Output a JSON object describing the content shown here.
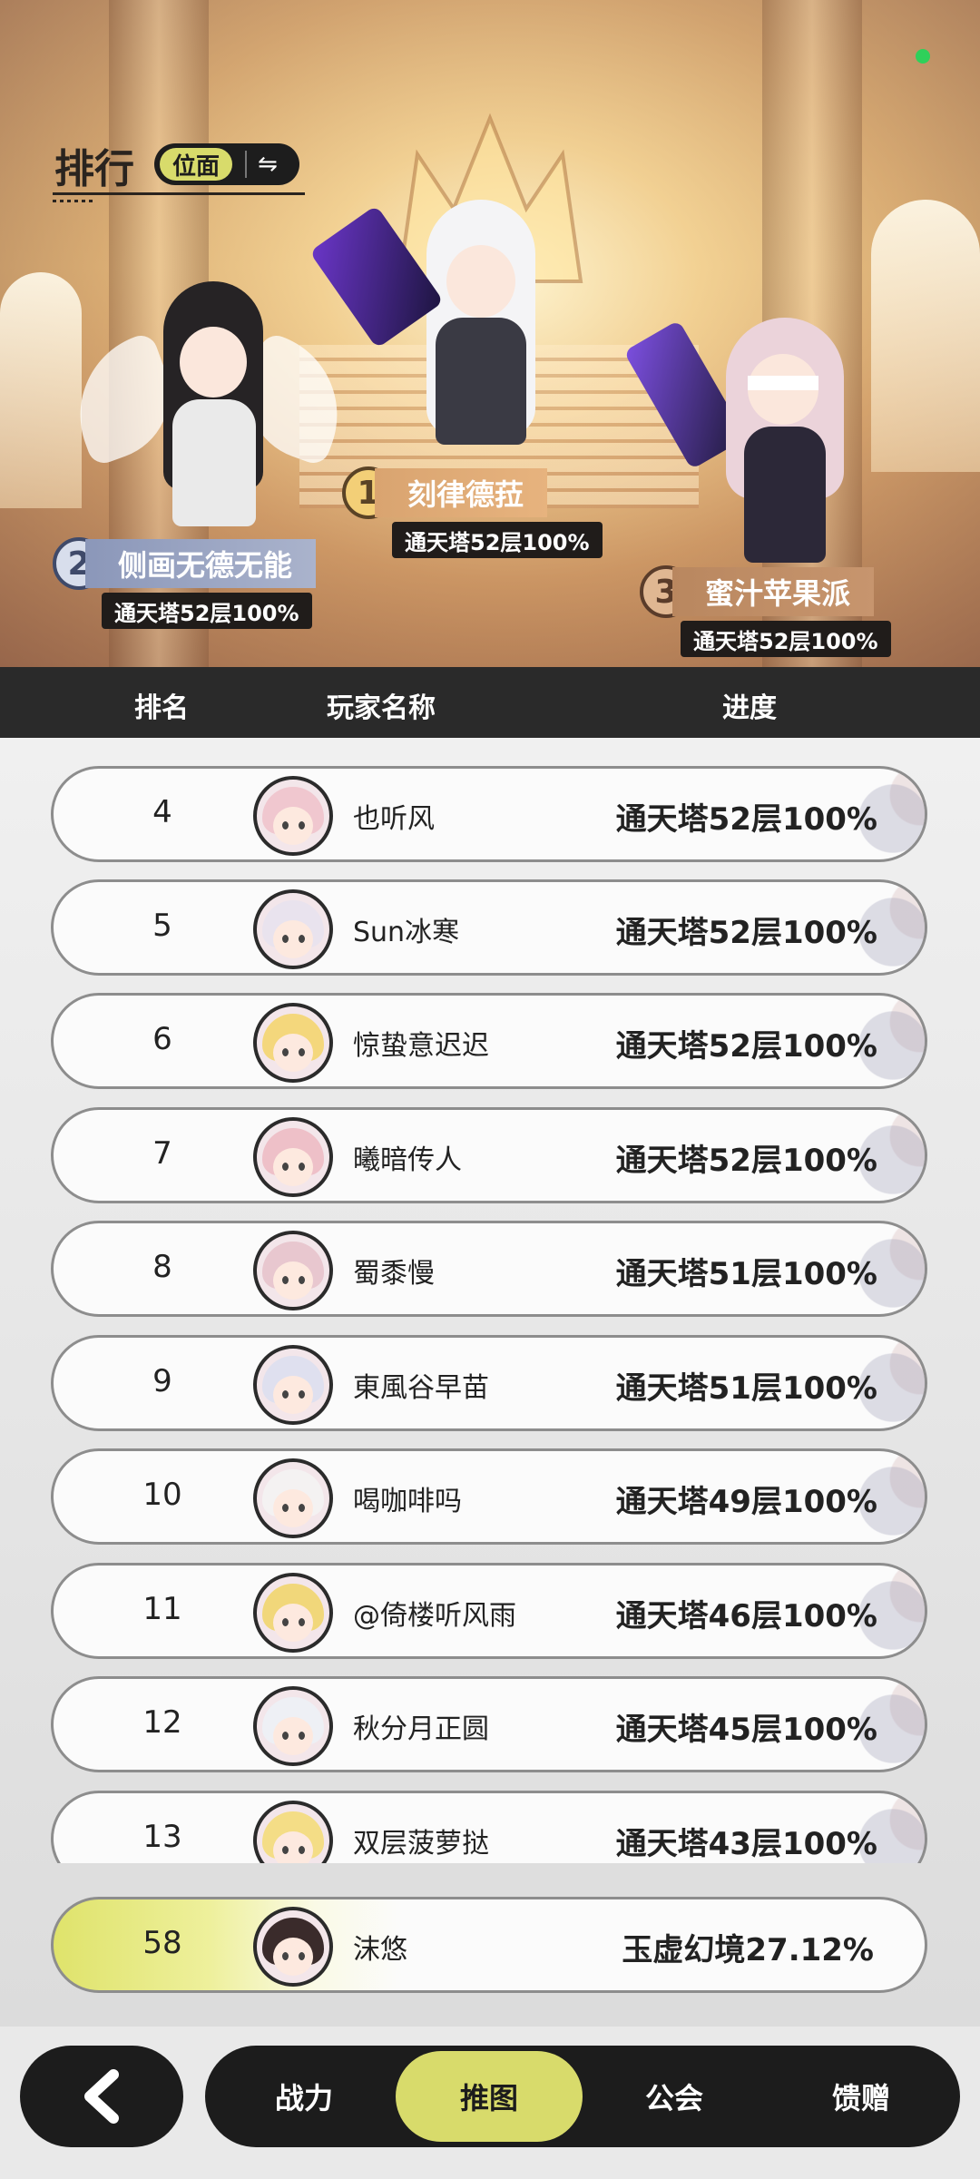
{
  "header": {
    "title": "排行",
    "realm_label": "位面",
    "swap_icon": "⇋"
  },
  "podium": [
    {
      "rank": "1",
      "name": "刻律德菈",
      "progress": "通天塔52层100%"
    },
    {
      "rank": "2",
      "name": "侧画无德无能",
      "progress": "通天塔52层100%"
    },
    {
      "rank": "3",
      "name": "蜜汁苹果派",
      "progress": "通天塔52层100%"
    }
  ],
  "table_header": {
    "rank": "排名",
    "player": "玩家名称",
    "progress": "进度"
  },
  "rows": [
    {
      "rank": "4",
      "name": "也听风",
      "progress": "通天塔52层100%",
      "hair": "#f0c7cf"
    },
    {
      "rank": "5",
      "name": "Sun冰寒",
      "progress": "通天塔52层100%",
      "hair": "#e9e3ee"
    },
    {
      "rank": "6",
      "name": "惊蛰意迟迟",
      "progress": "通天塔52层100%",
      "hair": "#f4d77c"
    },
    {
      "rank": "7",
      "name": "曦暗传人",
      "progress": "通天塔52层100%",
      "hair": "#eec0c8"
    },
    {
      "rank": "8",
      "name": "蜀黍慢",
      "progress": "通天塔51层100%",
      "hair": "#e8c7cf"
    },
    {
      "rank": "9",
      "name": "東風谷早苗",
      "progress": "通天塔51层100%",
      "hair": "#dfe0ef"
    },
    {
      "rank": "10",
      "name": "喝咖啡吗",
      "progress": "通天塔49层100%",
      "hair": "#f4f2f2"
    },
    {
      "rank": "11",
      "name": "@倚楼听风雨",
      "progress": "通天塔46层100%",
      "hair": "#f1d77a"
    },
    {
      "rank": "12",
      "name": "秋分月正圆",
      "progress": "通天塔45层100%",
      "hair": "#eef0f5"
    },
    {
      "rank": "13",
      "name": "双层菠萝挞",
      "progress": "通天塔43层100%",
      "hair": "#f4dd86"
    }
  ],
  "self": {
    "rank": "58",
    "name": "沫悠",
    "progress": "玉虚幻境27.12%",
    "hair": "#3a2b2b"
  },
  "nav": {
    "back_icon": "chevron-left",
    "tabs": [
      "战力",
      "推图",
      "公会",
      "馈赠"
    ],
    "active": "推图"
  },
  "colors": {
    "accent": "#d8db6b",
    "dark": "#1c1c1c",
    "gold_plate": "#e7b37e",
    "silver_plate": "#aab3cc",
    "bronze_plate": "#c7956e"
  }
}
